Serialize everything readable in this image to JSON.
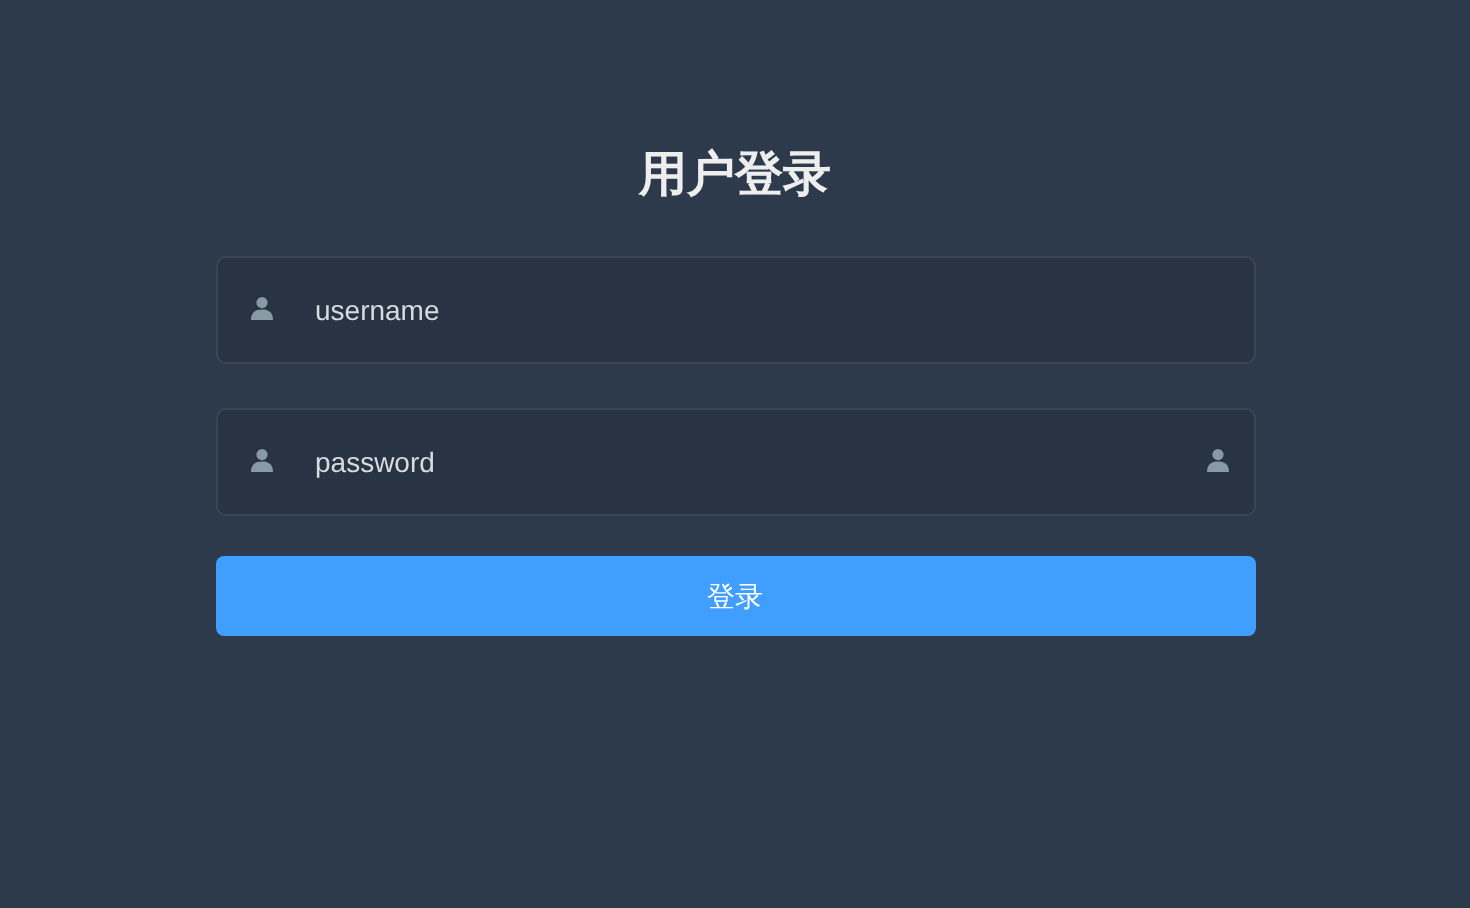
{
  "title": "用户登录",
  "fields": [
    {
      "value": "username",
      "trailing_icon": false
    },
    {
      "value": "password",
      "trailing_icon": true
    }
  ],
  "submit_button": "登录"
}
